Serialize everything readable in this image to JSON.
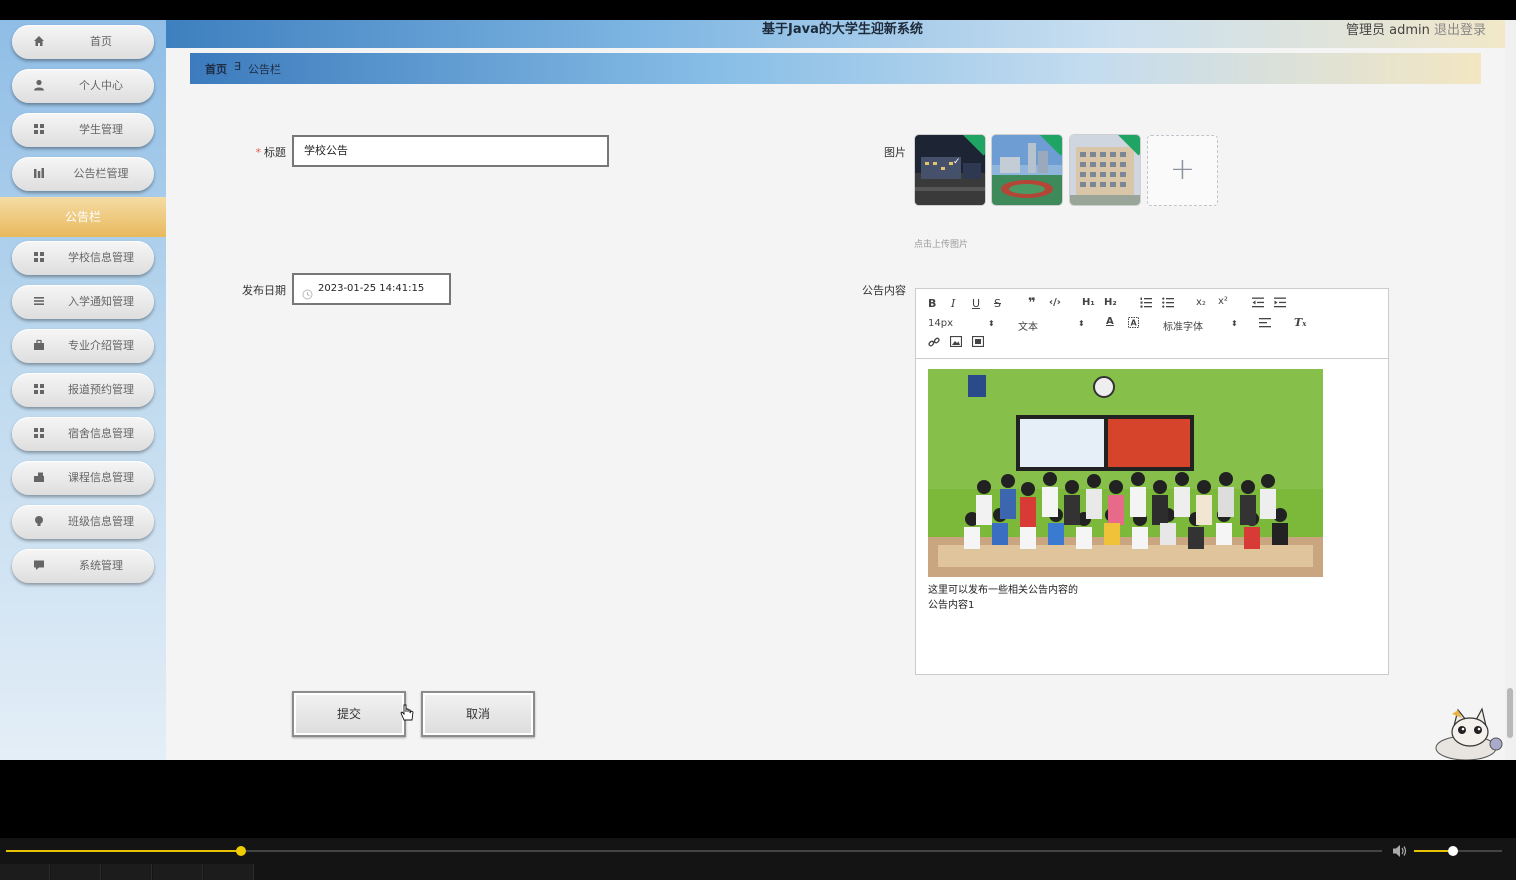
{
  "header": {
    "title": "基于Java的大学生迎新系统",
    "user": "管理员 admin",
    "logout": "退出登录"
  },
  "sidebar": {
    "items": [
      {
        "label": "首页",
        "icon": "home-icon"
      },
      {
        "label": "个人中心",
        "icon": "user-icon"
      },
      {
        "label": "学生管理",
        "icon": "grid-icon"
      },
      {
        "label": "公告栏管理",
        "icon": "chart-icon"
      },
      {
        "label": "学校信息管理",
        "icon": "grid-icon"
      },
      {
        "label": "入学通知管理",
        "icon": "list-icon"
      },
      {
        "label": "专业介绍管理",
        "icon": "briefcase-icon"
      },
      {
        "label": "报道预约管理",
        "icon": "grid-icon"
      },
      {
        "label": "宿舍信息管理",
        "icon": "grid-icon"
      },
      {
        "label": "课程信息管理",
        "icon": "case-icon"
      },
      {
        "label": "班级信息管理",
        "icon": "bulb-icon"
      },
      {
        "label": "系统管理",
        "icon": "message-icon"
      }
    ],
    "active_sub": "公告栏"
  },
  "breadcrumb": {
    "home": "首页",
    "separator": "∃",
    "current": "公告栏"
  },
  "form": {
    "title_label": "标题",
    "title_value": "学校公告",
    "date_label": "发布日期",
    "date_value": "2023-01-25 14:41:15",
    "image_label": "图片",
    "upload_hint": "点击上传图片",
    "content_label": "公告内容",
    "content_lines": [
      "这里可以发布一些相关公告内容的",
      "公告内容1"
    ],
    "submit": "提交",
    "cancel": "取消"
  },
  "editor": {
    "font_size": "14px",
    "paragraph": "文本",
    "font_family": "标准字体"
  },
  "player": {
    "progress": 0.171,
    "volume": 0.44
  }
}
